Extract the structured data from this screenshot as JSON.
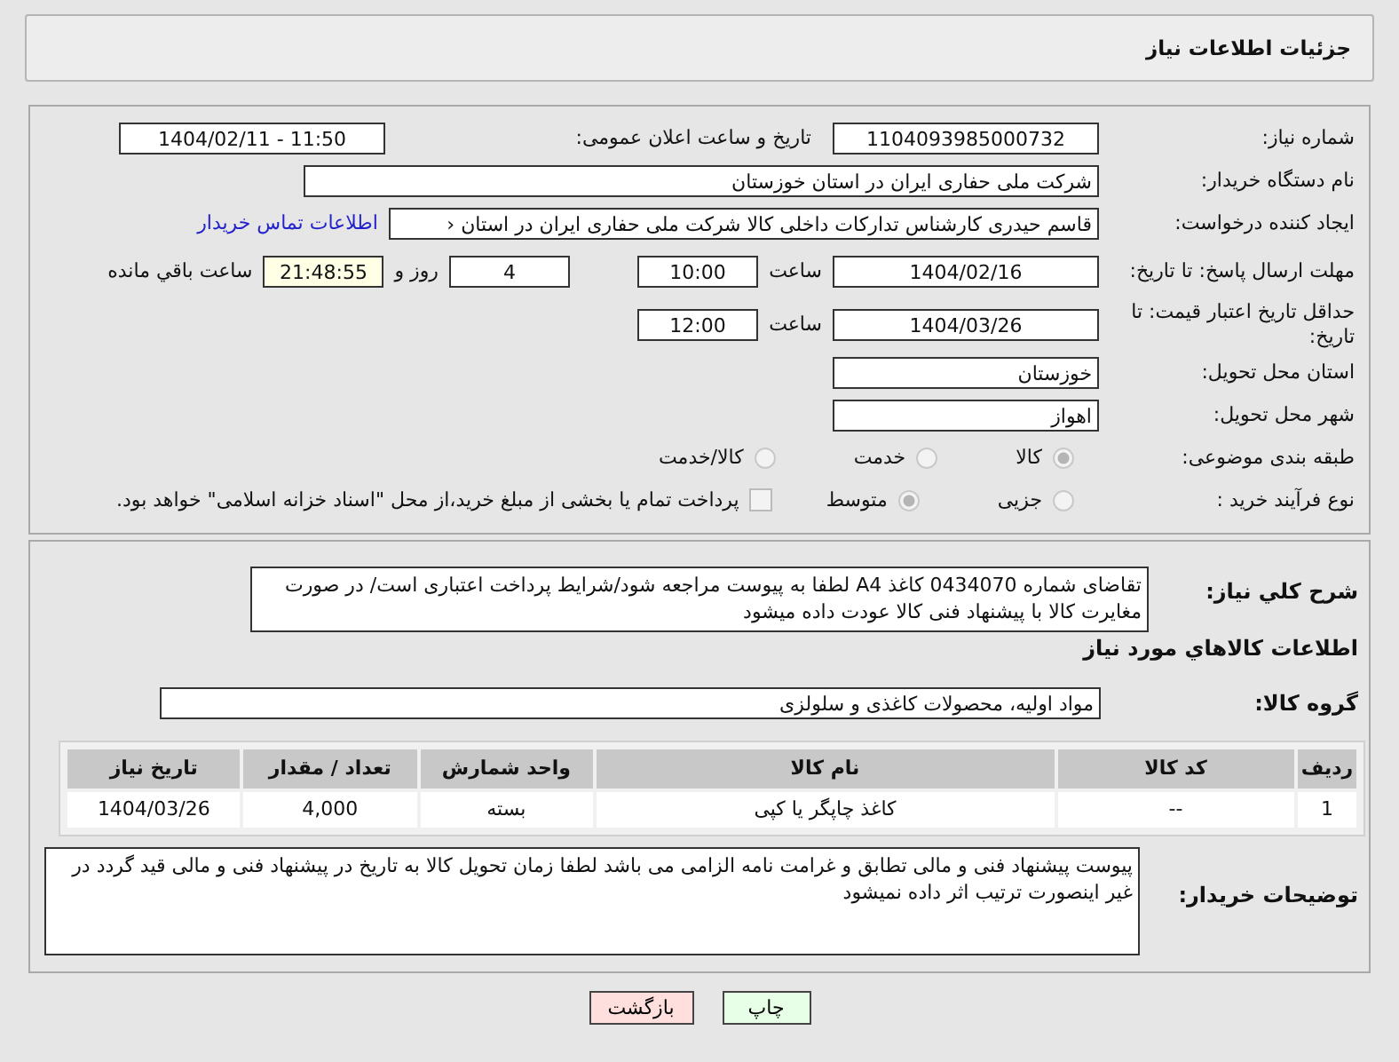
{
  "header": {
    "title": "جزئیات اطلاعات نیاز"
  },
  "need_number": {
    "label": "شماره نیاز:",
    "value": "1104093985000732"
  },
  "announce": {
    "label": "تاریخ و ساعت اعلان عمومی:",
    "value": "1404/02/11 - 11:50"
  },
  "buyer_org": {
    "label": "نام دستگاه خریدار:",
    "value": "شرکت ملی حفاری ایران در استان خوزستان"
  },
  "creator": {
    "label": "ایجاد کننده درخواست:",
    "value": "قاسم حیدری کارشناس تدارکات داخلی کالا شرکت ملی حفاری ایران در استان ‹",
    "link": "اطلاعات تماس خریدار"
  },
  "deadline": {
    "label": "مهلت ارسال پاسخ: تا تاریخ:",
    "date": "1404/02/16",
    "time_label": "ساعت",
    "time": "10:00",
    "days": "4",
    "days_label": "روز و",
    "remaining": "21:48:55",
    "remaining_label": "ساعت باقي مانده"
  },
  "validity": {
    "label": "حداقل تاریخ اعتبار قیمت: تا تاریخ:",
    "date": "1404/03/26",
    "time_label": "ساعت",
    "time": "12:00"
  },
  "province": {
    "label": "استان محل تحویل:",
    "value": "خوزستان"
  },
  "city": {
    "label": "شهر محل تحویل:",
    "value": "اهواز"
  },
  "category": {
    "label": "طبقه بندی موضوعی:",
    "options": [
      {
        "label": "کالا",
        "selected": true
      },
      {
        "label": "خدمت",
        "selected": false
      },
      {
        "label": "کالا/خدمت",
        "selected": false
      }
    ]
  },
  "process": {
    "label": "نوع فرآیند خرید :",
    "options": [
      {
        "label": "جزیی",
        "selected": false
      },
      {
        "label": "متوسط",
        "selected": true
      }
    ],
    "treasury": {
      "label": "پرداخت تمام یا بخشی از مبلغ خرید،از محل \"اسناد خزانه اسلامی\" خواهد بود.",
      "checked": false
    }
  },
  "description": {
    "label": "شرح کلي نياز:",
    "value": "تقاضای شماره 0434070 کاغذ A4 لطفا به پیوست مراجعه شود/شرایط پرداخت اعتباری است/ در صورت مغایرت کالا با پیشنهاد فنی کالا عودت داده میشود"
  },
  "goods_title": "اطلاعات کالاهاي مورد نياز",
  "goods_group": {
    "label": "گروه کالا:",
    "value": "مواد اولیه، محصولات کاغذی و سلولزی"
  },
  "table": {
    "columns": [
      "ردیف",
      "کد کالا",
      "نام کالا",
      "واحد شمارش",
      "تعداد / مقدار",
      "تاریخ نیاز"
    ],
    "rows": [
      [
        "1",
        "--",
        "کاغذ چاپگر یا کپی",
        "بسته",
        "4,000",
        "1404/03/26"
      ]
    ]
  },
  "buyer_notes": {
    "label": "توضیحات خریدار:",
    "value": "پیوست پیشنهاد فنی و مالی تطابق و غرامت نامه الزامی می باشد لطفا زمان تحویل کالا به تاریخ در پیشنهاد فنی و مالی قید گردد در غیر اینصورت ترتیب اثر داده نمیشود"
  },
  "buttons": [
    {
      "label": "چاپ",
      "kind": "print"
    },
    {
      "label": "بازگشت",
      "kind": "back"
    }
  ]
}
